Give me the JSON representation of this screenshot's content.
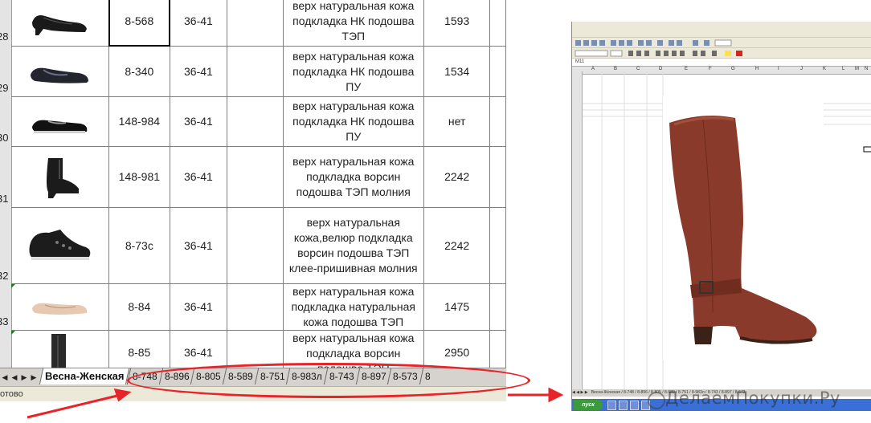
{
  "sheet": {
    "row_numbers": [
      "28",
      "29",
      "30",
      "31",
      "32",
      "33"
    ],
    "rows": [
      {
        "article": "8-568",
        "sizes": "36-41",
        "desc": "верх натуральная кожа подкладка НК подошва ТЭП",
        "price": "1593"
      },
      {
        "article": "8-340",
        "sizes": "36-41",
        "desc": "верх натуральная кожа подкладка НК подошва ПУ",
        "price": "1534"
      },
      {
        "article": "148-984",
        "sizes": "36-41",
        "desc": "верх натуральная кожа подкладка НК подошва ПУ",
        "price": "нет"
      },
      {
        "article": "148-981",
        "sizes": "36-41",
        "desc": "верх натуральная кожа подкладка ворсин подошва ТЭП молния",
        "price": "2242"
      },
      {
        "article": "8-73с",
        "sizes": "36-41",
        "desc": "верх натуральная кожа,велюр подкладка ворсин подошва ТЭП клее-пришивная молния",
        "price": "2242"
      },
      {
        "article": "8-84",
        "sizes": "36-41",
        "desc": "верх натуральная кожа подкладка натуральная кожа подошва ТЭП",
        "price": "1475"
      },
      {
        "article": "8-85",
        "sizes": "36-41",
        "desc": "верх натуральная кожа подкладка ворсин подошва ТЭП",
        "price": "2950"
      }
    ]
  },
  "tabs": {
    "active": "Весна-Женская",
    "others": [
      "8-748",
      "8-896",
      "8-805",
      "8-589",
      "8-751",
      "8-983л",
      "8-743",
      "8-897",
      "8-573",
      "8"
    ]
  },
  "status": "отово",
  "right_window": {
    "name_box": "M11",
    "col_letters": [
      "A",
      "B",
      "C",
      "D",
      "E",
      "F",
      "G",
      "H",
      "I",
      "J",
      "K",
      "L",
      "M",
      "N"
    ],
    "start_label": "пуск"
  },
  "watermark": "ДелаемПокупки.Ру",
  "colors": {
    "annotation_red": "#e8242b",
    "boot_brown": "#8a3a2a",
    "taskbar_blue": "#3a6fd8"
  }
}
